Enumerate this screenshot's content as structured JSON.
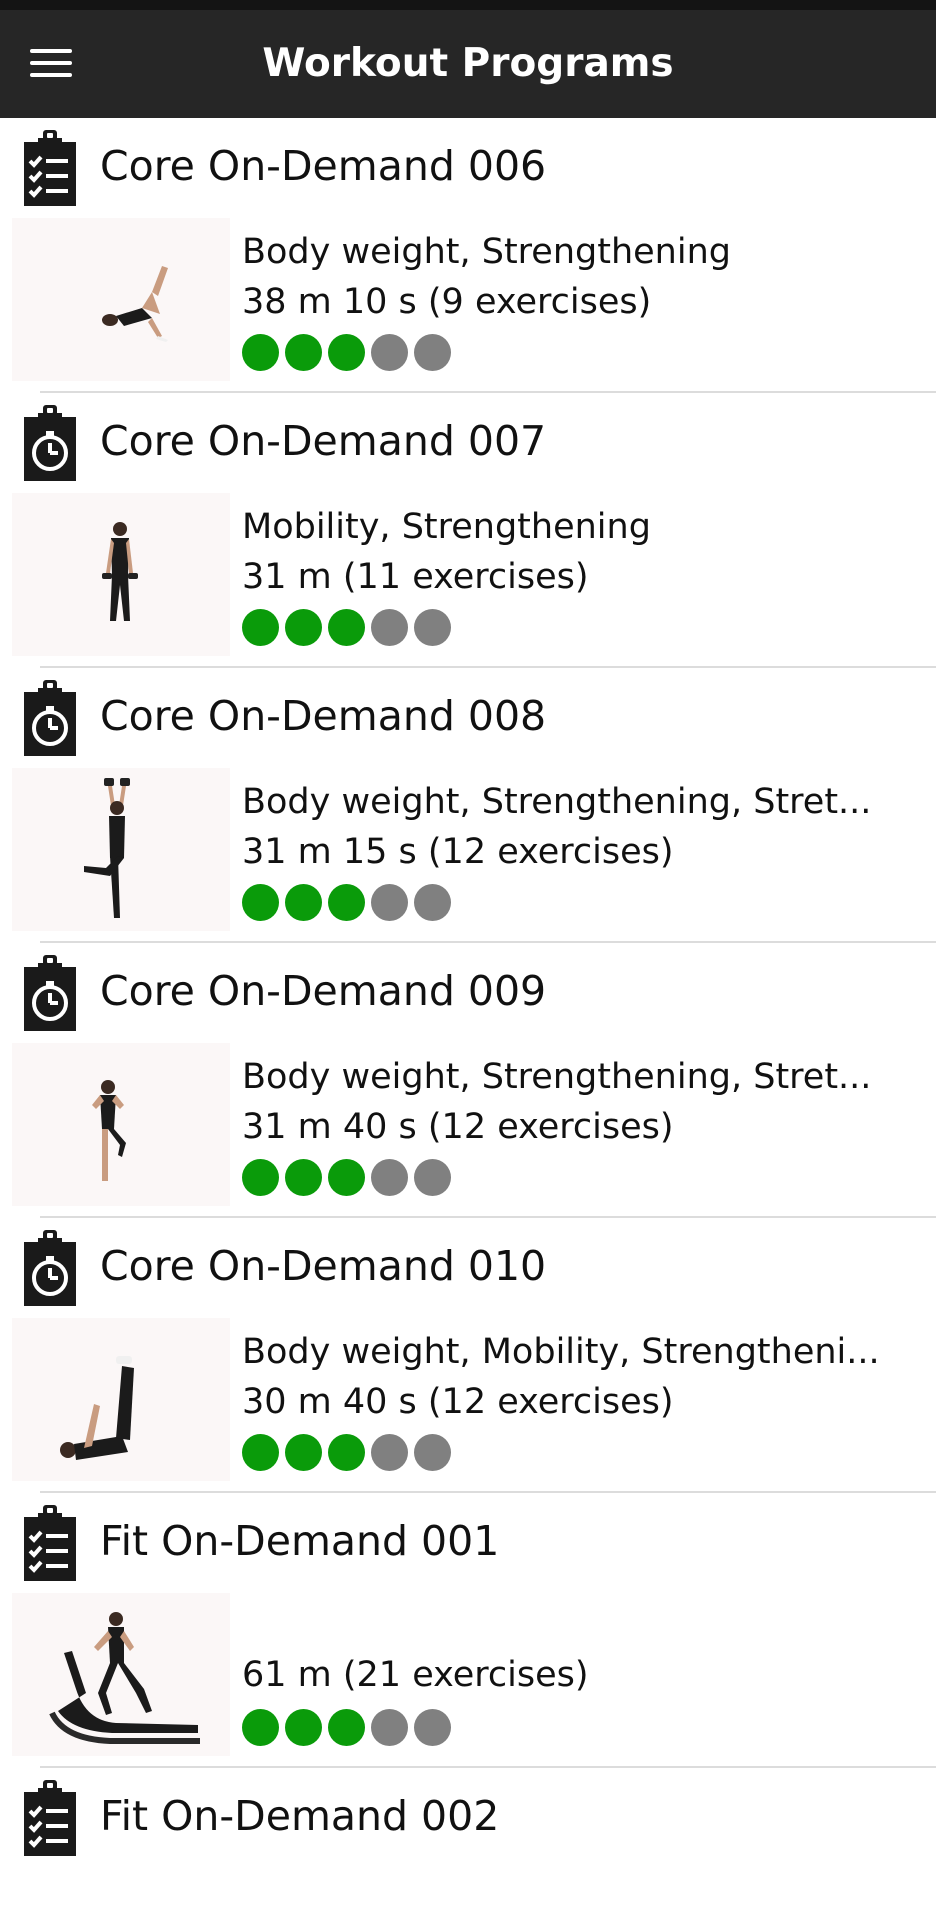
{
  "app_bar": {
    "title": "Workout Programs",
    "menu_icon": "hamburger-menu-icon",
    "background": "#262626"
  },
  "rating_colors": {
    "filled": "#0a9b0a",
    "empty": "#808080"
  },
  "programs": [
    {
      "name": "Core On-Demand 006",
      "icon": "clipboard-checklist-icon",
      "tags": "Body weight, Strengthening",
      "duration": "38 m 10 s (9 exercises)",
      "rating": 3,
      "rating_max": 5,
      "thumbnail": "woman-glute-bridge-leg-raise"
    },
    {
      "name": "Core On-Demand 007",
      "icon": "clipboard-stopwatch-icon",
      "tags": "Mobility, Strengthening",
      "duration": "31 m (11 exercises)",
      "rating": 3,
      "rating_max": 5,
      "thumbnail": "woman-standing-with-dumbbells"
    },
    {
      "name": "Core On-Demand 008",
      "icon": "clipboard-stopwatch-icon",
      "tags": "Body weight, Strengthening, Stret...",
      "duration": "31 m 15 s (12 exercises)",
      "rating": 3,
      "rating_max": 5,
      "thumbnail": "woman-overhead-dumbbell-knee-raise"
    },
    {
      "name": "Core On-Demand 009",
      "icon": "clipboard-stopwatch-icon",
      "tags": "Body weight, Strengthening, Stret...",
      "duration": "31 m 40 s (12 exercises)",
      "rating": 3,
      "rating_max": 5,
      "thumbnail": "man-standing-knee-raise"
    },
    {
      "name": "Core On-Demand 010",
      "icon": "clipboard-stopwatch-icon",
      "tags": "Body weight, Mobility, Strengtheni...",
      "duration": "30 m 40 s (12 exercises)",
      "rating": 3,
      "rating_max": 5,
      "thumbnail": "woman-lying-legs-raised"
    },
    {
      "name": "Fit On-Demand 001",
      "icon": "clipboard-checklist-icon",
      "tags": "",
      "duration": "61 m (21 exercises)",
      "rating": 3,
      "rating_max": 5,
      "thumbnail": "woman-running-curved-treadmill"
    },
    {
      "name": "Fit On-Demand 002",
      "icon": "clipboard-checklist-icon"
    }
  ]
}
